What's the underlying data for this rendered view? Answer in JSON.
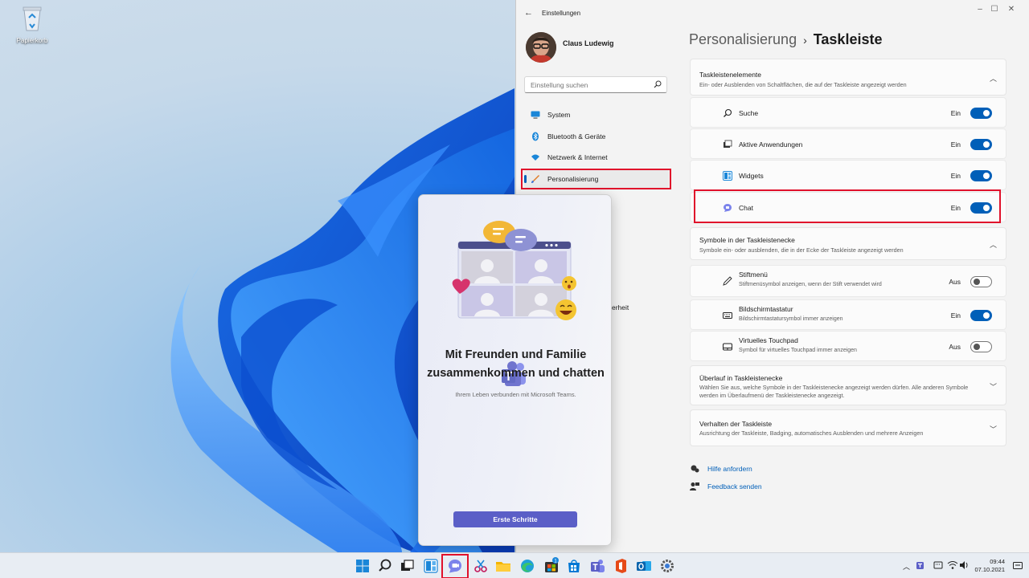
{
  "desktop": {
    "recycle_bin_label": "Papierkorb"
  },
  "settings": {
    "app_title": "Einstellungen",
    "user_name": "Claus Ludewig",
    "search_placeholder": "Einstellung suchen",
    "nav": [
      {
        "label": "System",
        "icon": "monitor-icon"
      },
      {
        "label": "Bluetooth & Geräte",
        "icon": "bluetooth-icon"
      },
      {
        "label": "Netzwerk & Internet",
        "icon": "wifi-icon"
      },
      {
        "label": "Personalisierung",
        "icon": "brush-icon",
        "active": true
      }
    ],
    "nav_partial_label": "erheit",
    "breadcrumb": {
      "parent": "Personalisierung",
      "separator": "›",
      "current": "Taskleiste"
    },
    "taskbar_items": {
      "title": "Taskleistenelemente",
      "desc": "Ein- oder Ausblenden von Schaltflächen, die auf der Taskleiste angezeigt werden",
      "rows": [
        {
          "label": "Suche",
          "state": "Ein",
          "on": true,
          "icon": "search-icon"
        },
        {
          "label": "Aktive Anwendungen",
          "state": "Ein",
          "on": true,
          "icon": "task-view-icon"
        },
        {
          "label": "Widgets",
          "state": "Ein",
          "on": true,
          "icon": "widgets-icon"
        },
        {
          "label": "Chat",
          "state": "Ein",
          "on": true,
          "icon": "chat-icon"
        }
      ]
    },
    "corner_icons": {
      "title": "Symbole in der Taskleistenecke",
      "desc": "Symbole ein- oder ausblenden, die in der Ecke der Taskleiste angezeigt werden",
      "rows": [
        {
          "label": "Stiftmenü",
          "sub": "Stiftmenüsymbol anzeigen, wenn der Stift verwendet wird",
          "state": "Aus",
          "on": false,
          "icon": "pen-icon"
        },
        {
          "label": "Bildschirmtastatur",
          "sub": "Bildschirmtastatursymbol immer anzeigen",
          "state": "Ein",
          "on": true,
          "icon": "keyboard-icon"
        },
        {
          "label": "Virtuelles Touchpad",
          "sub": "Symbol für virtuelles Touchpad immer anzeigen",
          "state": "Aus",
          "on": false,
          "icon": "touchpad-icon"
        }
      ]
    },
    "overflow": {
      "title": "Überlauf in Taskleistenecke",
      "desc": "Wählen Sie aus, welche Symbole in der Taskleistenecke angezeigt werden dürfen. Alle anderen Symbole werden im Überlaufmenü der Taskleistenecke angezeigt."
    },
    "behavior": {
      "title": "Verhalten der Taskleiste",
      "desc": "Ausrichtung der Taskleiste, Badging, automatisches Ausblenden und mehrere Anzeigen"
    },
    "links": {
      "help": "Hilfe anfordern",
      "feedback": "Feedback senden"
    }
  },
  "chat_flyout": {
    "heading": "Mit Freunden und Familie zusammenkommen und chatten",
    "sub": "Ihrem Leben verbunden mit Microsoft Teams.",
    "button": "Erste Schritte"
  },
  "taskbar": {
    "teams_badge": "1",
    "clock_time": "09:44",
    "clock_date": "07.10.2021"
  },
  "colors": {
    "accent": "#005fb8",
    "highlight": "#e0112b",
    "teams": "#5b5fc7"
  }
}
